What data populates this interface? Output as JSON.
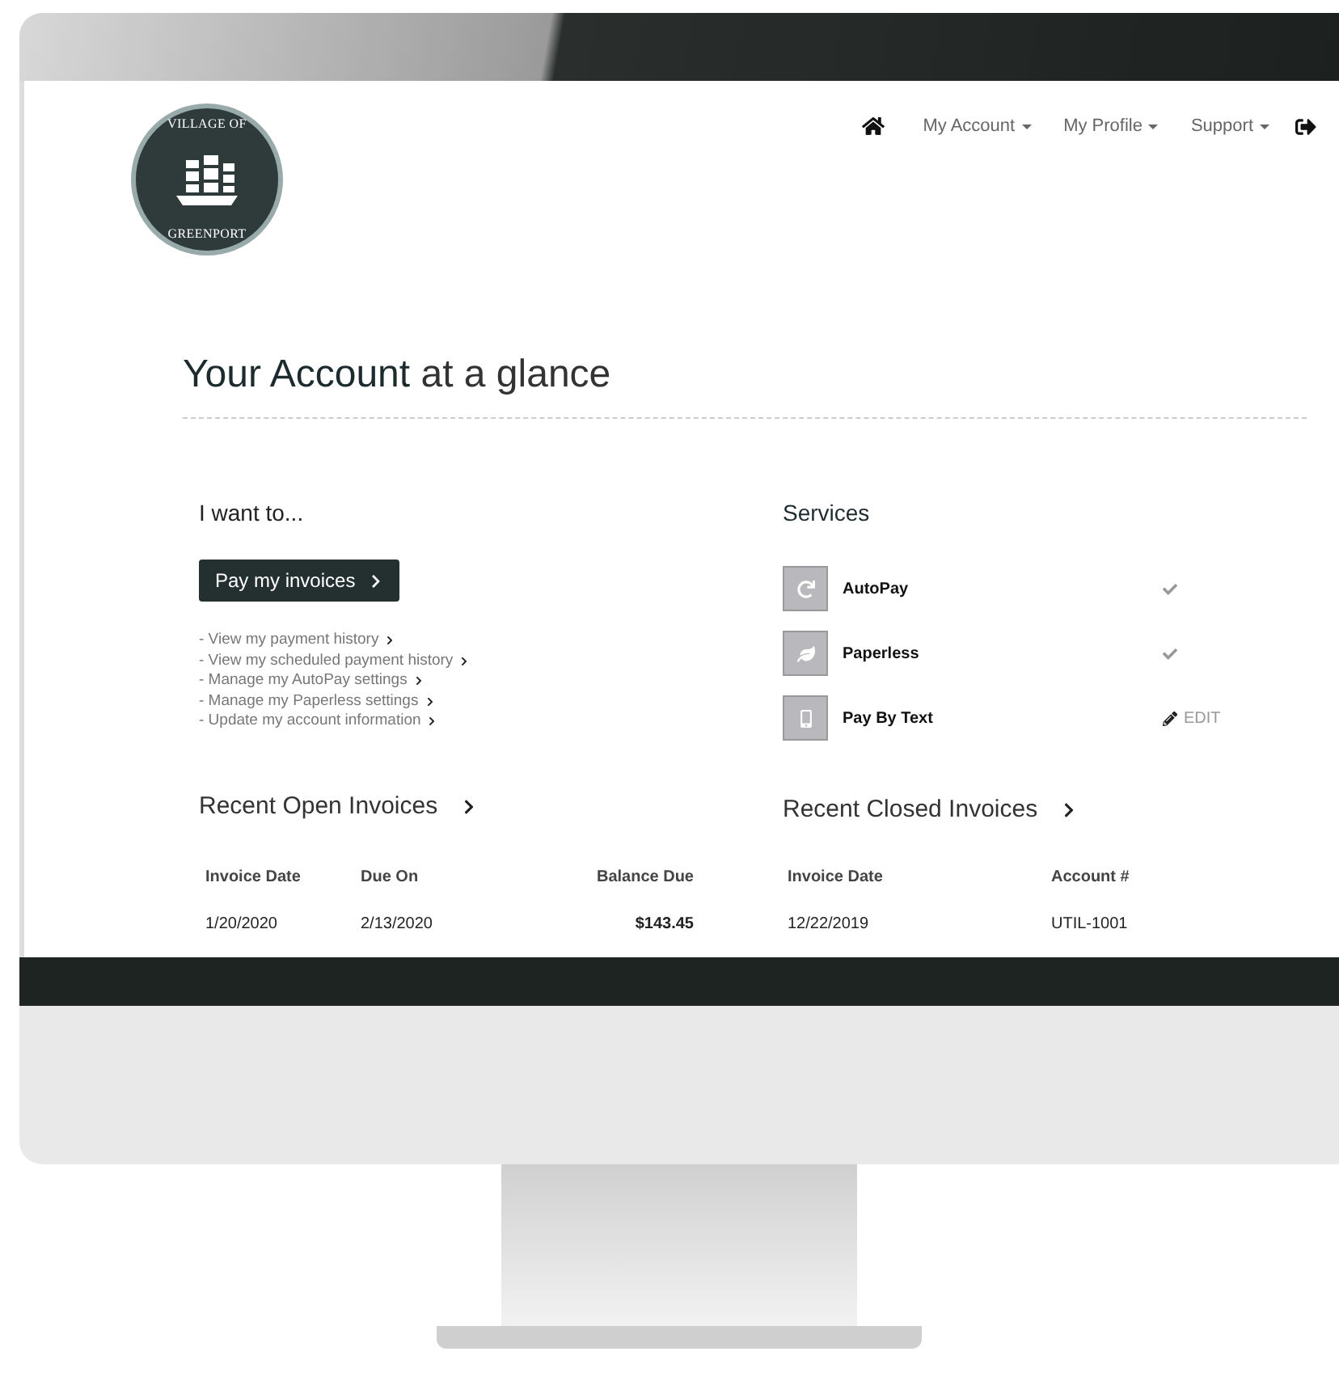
{
  "logo": {
    "top_text": "VILLAGE OF",
    "bottom_text": "GREENPORT"
  },
  "nav": [
    {
      "kind": "home"
    },
    {
      "kind": "menu",
      "label": "My Account"
    },
    {
      "kind": "menu",
      "label": "My Profile"
    },
    {
      "kind": "menu",
      "label": "Support"
    },
    {
      "kind": "logout"
    }
  ],
  "title": {
    "strong": "Your Account",
    "rest": "at a glance"
  },
  "i_want_to": {
    "heading": "I want to...",
    "primary_button": "Pay my invoices",
    "links": [
      "- View my payment history",
      "- View my scheduled payment history",
      "- Manage my AutoPay settings",
      "- Manage my Paperless settings",
      "- Update my account information"
    ]
  },
  "services": {
    "heading": "Services",
    "items": [
      {
        "name": "AutoPay",
        "kind": "check"
      },
      {
        "name": "Paperless",
        "kind": "check"
      },
      {
        "name": "Pay By Text",
        "kind": "edit",
        "action": "EDIT"
      }
    ]
  },
  "open_invoices": {
    "heading": "Recent Open Invoices",
    "columns": [
      "Invoice Date",
      "Due On",
      "Balance Due"
    ],
    "rows": [
      [
        "1/20/2020",
        "2/13/2020",
        "$143.45"
      ]
    ]
  },
  "closed_invoices": {
    "heading": "Recent Closed Invoices",
    "columns": [
      "Invoice Date",
      "Account #"
    ],
    "rows": [
      [
        "12/22/2019",
        "UTIL-1001"
      ]
    ]
  }
}
